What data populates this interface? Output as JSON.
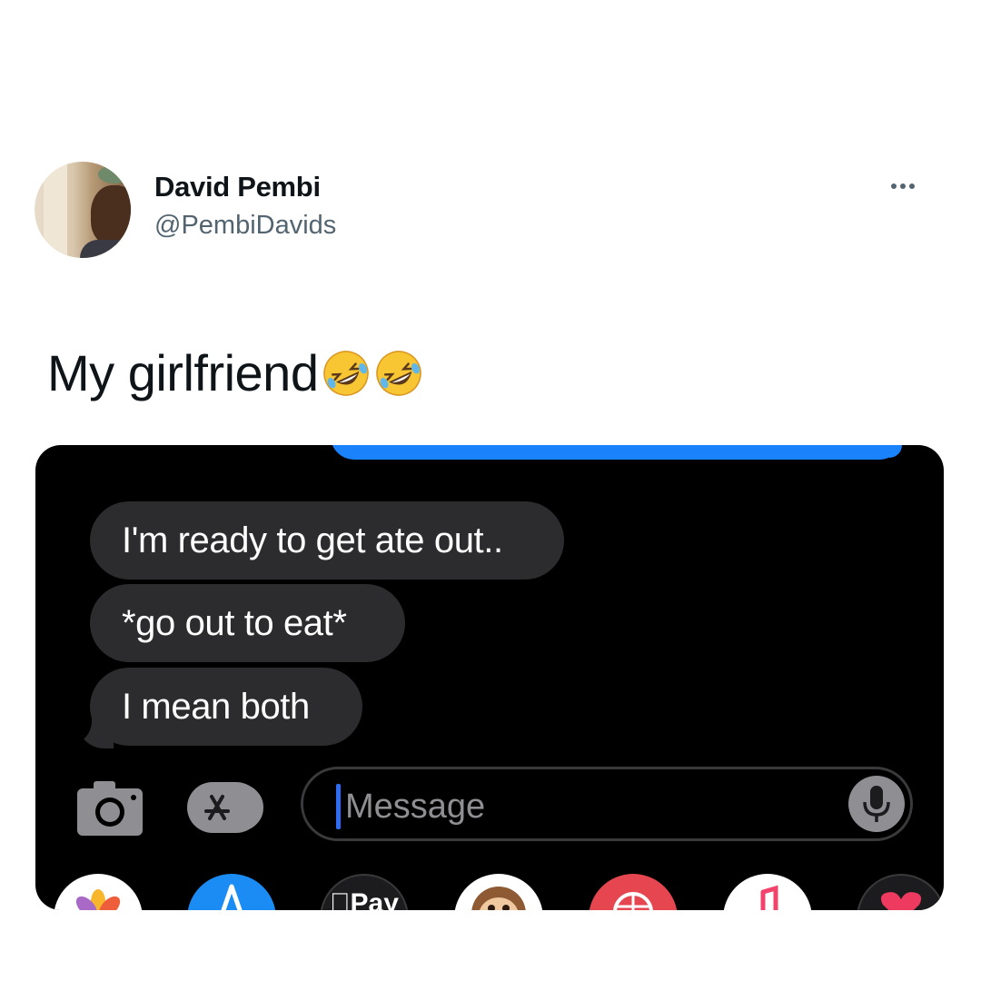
{
  "tweet": {
    "author_name": "David Pembi",
    "author_handle": "@PembiDavids",
    "text": "My girlfriend",
    "emoji_count": 2,
    "emoji": "rolling-on-floor-laughing"
  },
  "imessage": {
    "messages": [
      {
        "text": "I'm ready to get ate out..",
        "direction": "incoming"
      },
      {
        "text": "*go out to eat*",
        "direction": "incoming"
      },
      {
        "text": "I mean both",
        "direction": "incoming"
      }
    ],
    "input_placeholder": "Message",
    "app_drawer": [
      "photos-icon",
      "app-store-icon",
      "apple-pay-icon",
      "animoji-icon",
      "web-images-icon",
      "music-icon",
      "digital-touch-icon"
    ],
    "pay_label": "Pay"
  },
  "colors": {
    "incoming_bubble": "#2c2c2e",
    "outgoing_bubble": "#1a82fb",
    "background_dark": "#000000",
    "handle_gray": "#536471"
  }
}
